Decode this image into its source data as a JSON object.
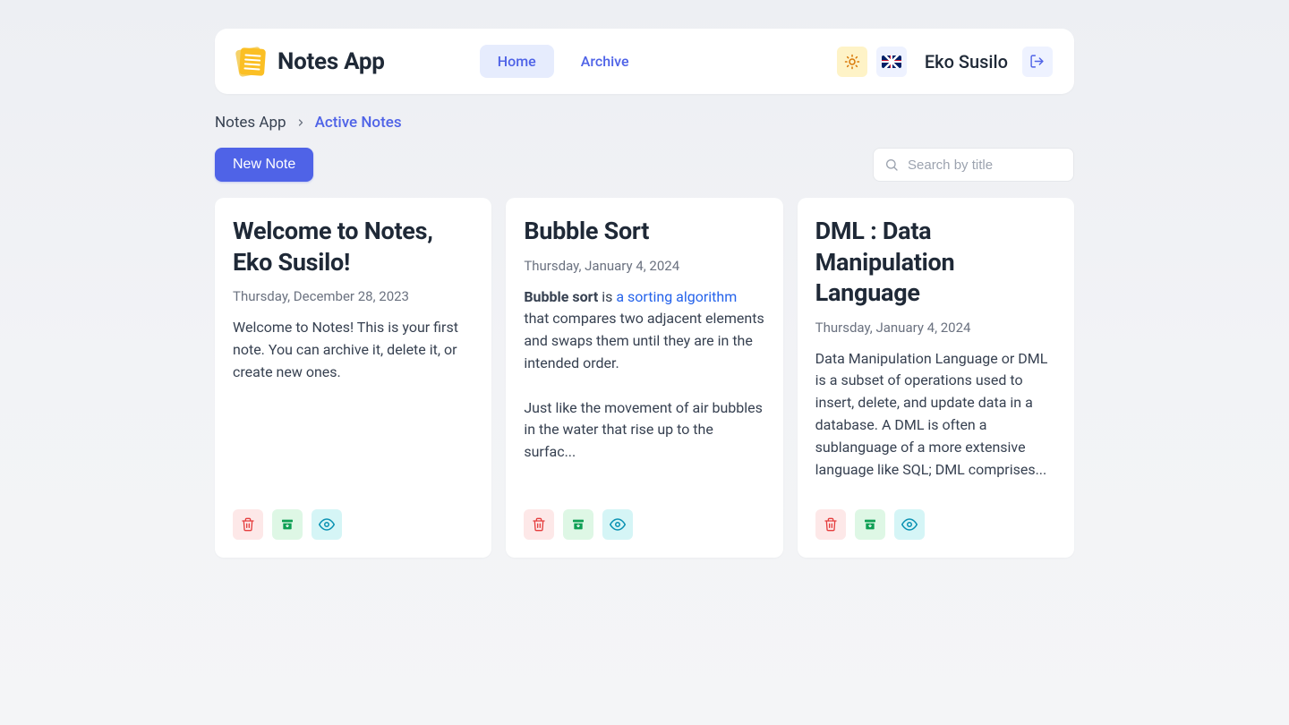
{
  "brand": {
    "title": "Notes App"
  },
  "nav": {
    "home": "Home",
    "archive": "Archive"
  },
  "user": {
    "name": "Eko Susilo"
  },
  "breadcrumb": {
    "root": "Notes App",
    "current": "Active Notes"
  },
  "toolbar": {
    "new_note": "New Note"
  },
  "search": {
    "placeholder": "Search by title"
  },
  "cards": [
    {
      "title": "Welcome to Notes, Eko Susilo!",
      "date": "Thursday, December 28, 2023",
      "body_html": "Welcome to Notes! This is your first note. You can archive it, delete it, or create new ones."
    },
    {
      "title": "Bubble Sort",
      "date": "Thursday, January 4, 2024",
      "body_html": "<span class='bold'>Bubble sort</span> is <span class='link'>a sorting algorithm</span> that compares two adjacent elements and swaps them until they are in the intended order.<br><br>Just like the movement of air bubbles in the water that rise up to the surfac..."
    },
    {
      "title": "DML : Data Manipulation Language",
      "date": "Thursday, January 4, 2024",
      "body_html": "Data Manipulation Language or DML is a subset of operations used to insert, delete, and update data in a database. A DML is often a sublanguage of a more extensive language like SQL; DML comprises..."
    }
  ]
}
